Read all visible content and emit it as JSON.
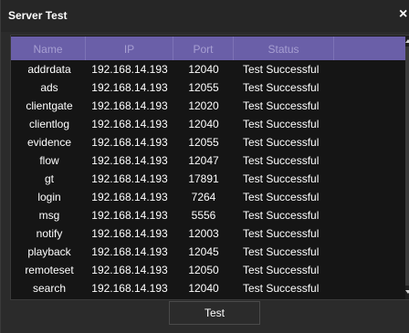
{
  "window": {
    "title": "Server Test",
    "close_glyph": "×"
  },
  "table": {
    "columns": [
      "Name",
      "IP",
      "Port",
      "Status"
    ],
    "rows": [
      {
        "name": "addrdata",
        "ip": "192.168.14.193",
        "port": "12040",
        "status": "Test Successful"
      },
      {
        "name": "ads",
        "ip": "192.168.14.193",
        "port": "12055",
        "status": "Test Successful"
      },
      {
        "name": "clientgate",
        "ip": "192.168.14.193",
        "port": "12020",
        "status": "Test Successful"
      },
      {
        "name": "clientlog",
        "ip": "192.168.14.193",
        "port": "12040",
        "status": "Test Successful"
      },
      {
        "name": "evidence",
        "ip": "192.168.14.193",
        "port": "12055",
        "status": "Test Successful"
      },
      {
        "name": "flow",
        "ip": "192.168.14.193",
        "port": "12047",
        "status": "Test Successful"
      },
      {
        "name": "gt",
        "ip": "192.168.14.193",
        "port": "17891",
        "status": "Test Successful"
      },
      {
        "name": "login",
        "ip": "192.168.14.193",
        "port": "7264",
        "status": "Test Successful"
      },
      {
        "name": "msg",
        "ip": "192.168.14.193",
        "port": "5556",
        "status": "Test Successful"
      },
      {
        "name": "notify",
        "ip": "192.168.14.193",
        "port": "12003",
        "status": "Test Successful"
      },
      {
        "name": "playback",
        "ip": "192.168.14.193",
        "port": "12045",
        "status": "Test Successful"
      },
      {
        "name": "remoteset",
        "ip": "192.168.14.193",
        "port": "12050",
        "status": "Test Successful"
      },
      {
        "name": "search",
        "ip": "192.168.14.193",
        "port": "12040",
        "status": "Test Successful"
      }
    ]
  },
  "buttons": {
    "test_label": "Test"
  },
  "colors": {
    "header_bg": "#6a5fa8",
    "header_text": "#a79fd2",
    "window_bg": "#2b2b2b",
    "panel_bg": "#151515"
  }
}
